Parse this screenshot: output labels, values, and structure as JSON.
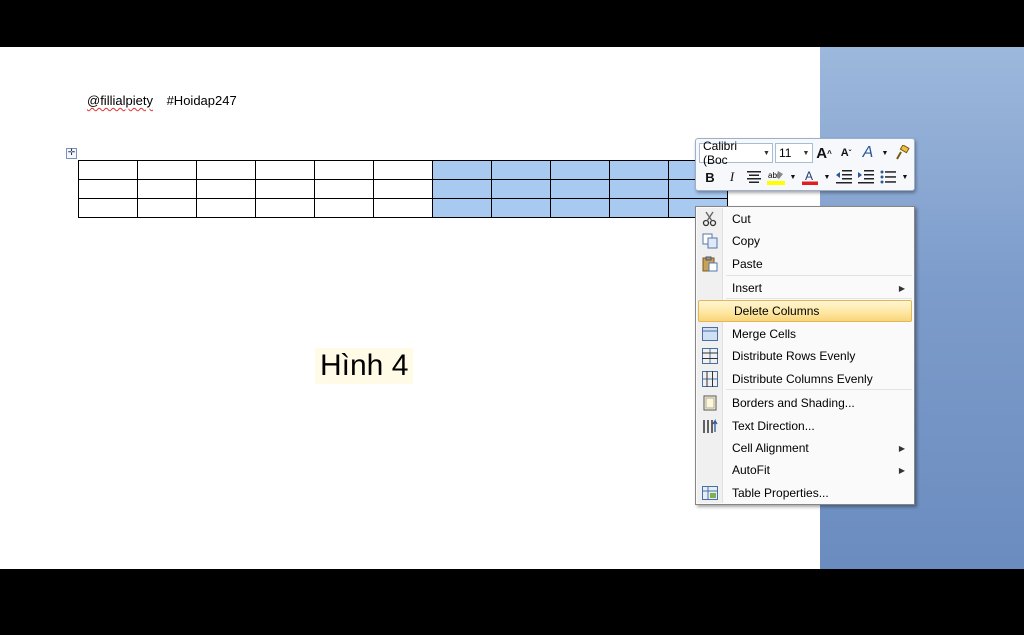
{
  "page": {
    "user_handle": "@fillialpiety",
    "hashtag": "#Hoidap247",
    "caption": "Hình 4"
  },
  "table": {
    "rows": 3,
    "columns": 11,
    "selected_columns": [
      6,
      7,
      8,
      9,
      10
    ]
  },
  "mini_toolbar": {
    "font_name": "Calibri (Boc",
    "font_size": "11",
    "grow_font": "A",
    "shrink_font": "A",
    "styles": "A",
    "bold": "B",
    "italic": "I",
    "highlight_color": "#ffff00",
    "font_color": "#e02020"
  },
  "context_menu": {
    "items": [
      {
        "label": "Cut",
        "icon": "scissors-icon"
      },
      {
        "label": "Copy",
        "icon": "copy-icon"
      },
      {
        "label": "Paste",
        "icon": "paste-icon"
      },
      {
        "label": "Insert",
        "icon": "",
        "submenu": true
      },
      {
        "label": "Delete Columns",
        "icon": "",
        "active": true
      },
      {
        "label": "Merge Cells",
        "icon": "merge-cells-icon"
      },
      {
        "label": "Distribute Rows Evenly",
        "icon": "distribute-rows-icon"
      },
      {
        "label": "Distribute Columns Evenly",
        "icon": "distribute-columns-icon"
      },
      {
        "label": "Borders and Shading...",
        "icon": "borders-shading-icon"
      },
      {
        "label": "Text Direction...",
        "icon": "text-direction-icon"
      },
      {
        "label": "Cell Alignment",
        "icon": "",
        "submenu": true
      },
      {
        "label": "AutoFit",
        "icon": "",
        "submenu": true
      },
      {
        "label": "Table Properties...",
        "icon": "table-properties-icon"
      }
    ]
  },
  "colors": {
    "selection": "#a8caf0",
    "menu_highlight": "#fde6a0"
  }
}
